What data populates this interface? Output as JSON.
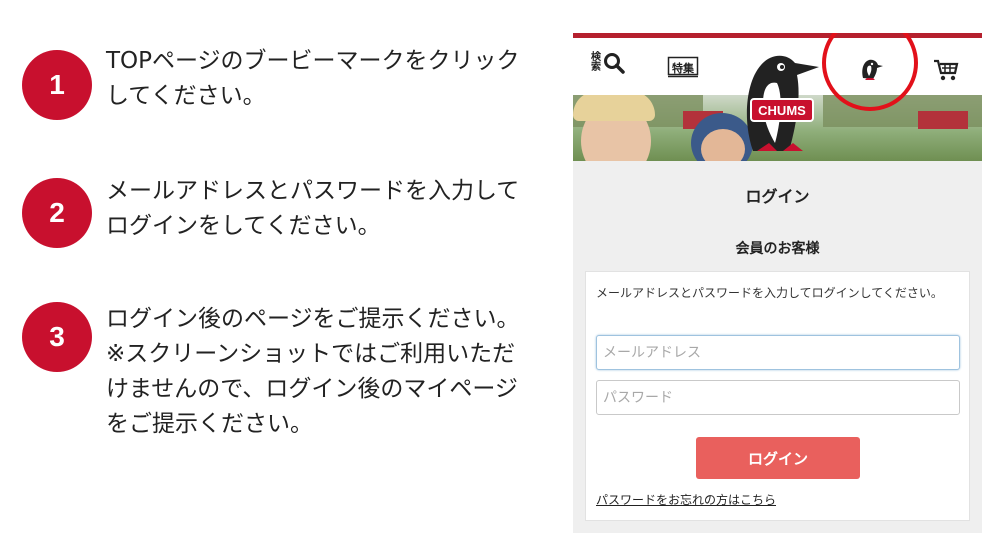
{
  "steps": [
    {
      "number": "1",
      "text": "TOPページのブービーマークをクリック\nしてください。"
    },
    {
      "number": "2",
      "text": "メールアドレスとパスワードを入力して\nログインをしてください。"
    },
    {
      "number": "3",
      "text": "ログイン後のページをご提示ください。\n※スクリーンショットではご利用いただ\nけませんので、ログイン後のマイページ\nをご提示ください。"
    }
  ],
  "header": {
    "search_label": "検索",
    "feature_label": "特集",
    "brand_logo_text": "CHUMS"
  },
  "login": {
    "title": "ログイン",
    "member_title": "会員のお客様",
    "description": "メールアドレスとパスワードを入力してログインしてください。",
    "email_placeholder": "メールアドレス",
    "password_placeholder": "パスワード",
    "button_label": "ログイン",
    "forgot_link": "パスワードをお忘れの方はこちら"
  },
  "colors": {
    "accent": "#c8102e",
    "highlight_circle": "#e2101a",
    "login_button": "#e9605d",
    "panel_bg": "#efefef"
  },
  "icons": [
    "search-icon",
    "book-icon",
    "booby-bird-icon",
    "cart-icon"
  ]
}
